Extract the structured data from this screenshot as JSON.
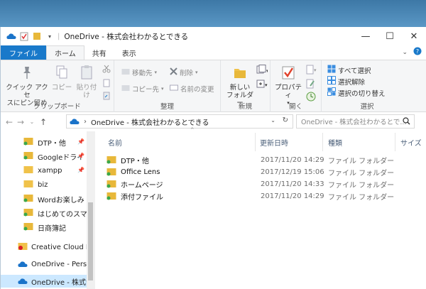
{
  "window": {
    "title": "OneDrive - 株式会社わかるとできる",
    "controls": {
      "minimize": "—",
      "maximize": "☐",
      "close": "✕"
    }
  },
  "tabs": [
    {
      "label": "ファイル"
    },
    {
      "label": "ホーム"
    },
    {
      "label": "共有"
    },
    {
      "label": "表示"
    }
  ],
  "ribbon": {
    "clipboard": {
      "label": "クリップボード",
      "pin": [
        "クイック アクセ",
        "スにピン留め"
      ],
      "copy": "コピー",
      "paste": "貼り付け"
    },
    "organize": {
      "label": "整理",
      "move_to": "移動先",
      "copy_to": "コピー先",
      "delete": "削除",
      "rename": "名前の変更"
    },
    "new": {
      "label": "新規",
      "new_folder": [
        "新しい",
        "フォルダー"
      ]
    },
    "open": {
      "label": "開く",
      "properties": "プロパティ"
    },
    "select": {
      "label": "選択",
      "select_all": "すべて選択",
      "select_none": "選択解除",
      "invert": "選択の切り替え"
    }
  },
  "address": {
    "path": "OneDrive - 株式会社わかるとできる",
    "search_placeholder": "OneDrive - 株式会社わかるとで..."
  },
  "nav": {
    "items": [
      {
        "label": "DTP・他",
        "pinned": true
      },
      {
        "label": "Googleドライ",
        "pinned": true
      },
      {
        "label": "xampp",
        "pinned": true
      },
      {
        "label": "biz",
        "pinned": false
      },
      {
        "label": "Wordお楽しみ",
        "pinned": false
      },
      {
        "label": "はじめてのスマート",
        "pinned": false
      },
      {
        "label": "日商簿記",
        "pinned": false
      }
    ],
    "creative_cloud": "Creative Cloud File",
    "onedrive_personal": "OneDrive - Person",
    "onedrive_business": "OneDrive - 株式会"
  },
  "columns": {
    "name": "名前",
    "modified": "更新日時",
    "type": "種類",
    "size": "サイズ"
  },
  "files": [
    {
      "name": "DTP・他",
      "modified": "2017/11/20 14:29",
      "type": "ファイル フォルダー"
    },
    {
      "name": "Office Lens",
      "modified": "2017/12/19 15:06",
      "type": "ファイル フォルダー"
    },
    {
      "name": "ホームページ",
      "modified": "2017/11/20 14:33",
      "type": "ファイル フォルダー"
    },
    {
      "name": "添付ファイル",
      "modified": "2017/11/20 14:29",
      "type": "ファイル フォルダー"
    }
  ],
  "colors": {
    "file_tab": "#1979ca",
    "folder": "#e8b83a",
    "sync_ok": "#3aa84a",
    "selected": "#cce8ff"
  }
}
